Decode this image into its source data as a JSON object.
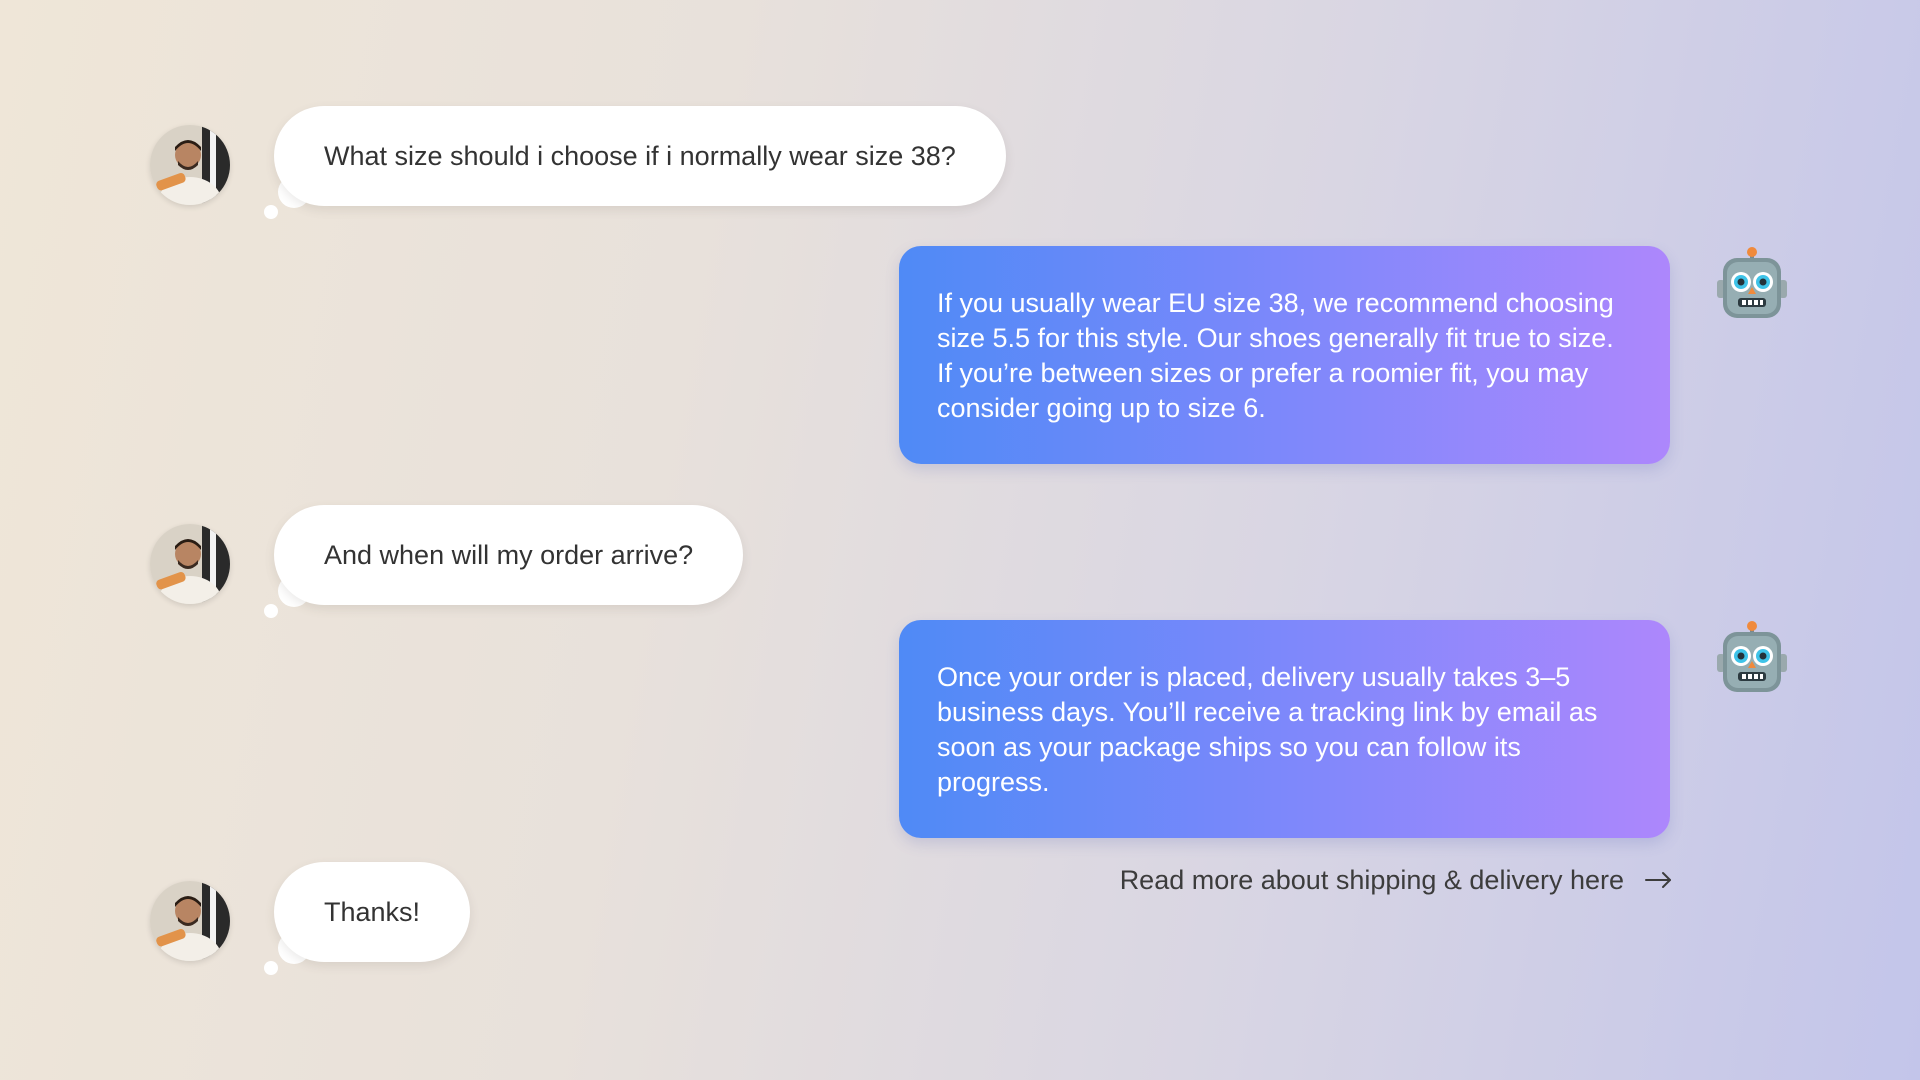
{
  "messages": [
    {
      "from": "user",
      "text": "What size should i choose if i normally wear size 38?"
    },
    {
      "from": "bot",
      "text": "If you usually wear EU size 38, we recommend choosing size 5.5 for this style. Our shoes generally fit true to size. If you’re between sizes or prefer a roomier fit, you may consider going up to size 6."
    },
    {
      "from": "user",
      "text": "And when will my order arrive?"
    },
    {
      "from": "bot",
      "text": "Once your order is placed, delivery usually takes 3–5 business days. You’ll receive a tracking link by email as soon as your package ships so you can follow its progress."
    },
    {
      "from": "user",
      "text": "Thanks!"
    }
  ],
  "link": {
    "label": "Read more about shipping & delivery here",
    "icon": "arrow-right-icon"
  },
  "icons": {
    "user_avatar": "user-avatar",
    "bot_avatar": "robot-icon"
  },
  "colors": {
    "bot_gradient_start": "#4f8af6",
    "bot_gradient_end": "#ad87fc",
    "user_bubble": "#ffffff",
    "text_dark": "#333333"
  }
}
